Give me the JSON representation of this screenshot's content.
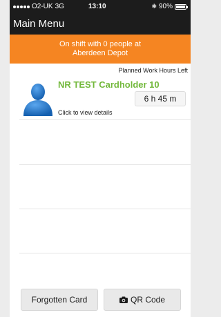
{
  "status": {
    "carrier": "O2-UK",
    "network": "3G",
    "time": "13:10",
    "battery": "90%"
  },
  "nav": {
    "title": "Main Menu"
  },
  "banner": {
    "line1": "On shift with 0 people at",
    "line2": "Aberdeen Depot"
  },
  "card": {
    "hours_header": "Planned Work Hours Left",
    "name": "NR TEST Cardholder 10",
    "hours_left": "6 h 45 m",
    "details_link": "Click to view details"
  },
  "buttons": {
    "forgotten_card": "Forgotten Card",
    "qr_code": "QR Code"
  },
  "colors": {
    "accent_orange": "#f58522",
    "name_green": "#72b83b",
    "bar_dark": "#1c1c1c",
    "avatar_blue": "#1a74c8"
  },
  "icons": {
    "avatar": "person-silhouette-icon",
    "camera": "camera-icon",
    "bluetooth": "bluetooth-icon",
    "battery": "battery-icon"
  }
}
